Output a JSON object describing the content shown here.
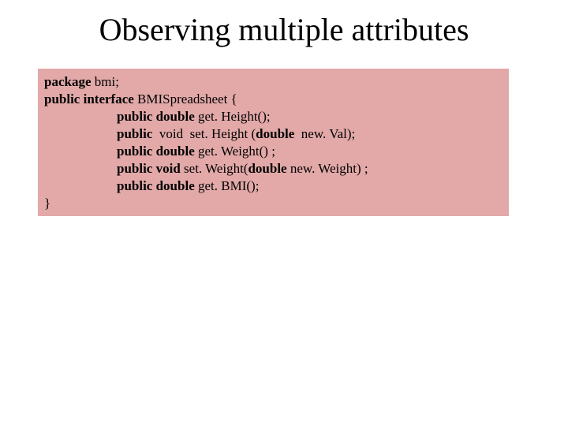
{
  "title": "Observing multiple attributes",
  "code": {
    "l1_kw_package": "package",
    "l1_rest": " bmi; ",
    "l2_kw": "public interface",
    "l2_rest": " BMISpreadsheet {",
    "l3_kw1": "public double",
    "l3_rest": " get. Height(); ",
    "l4_kw1": "public",
    "l4_mid1": "  void  set. Height (",
    "l4_kw2": "double",
    "l4_mid2": "  new. Val); ",
    "l5_kw1": "public double",
    "l5_rest": " get. Weight() ;",
    "l6_kw1": "public void",
    "l6_mid1": " set. Weight(",
    "l6_kw2": "double",
    "l6_mid2": " new. Weight) ;",
    "l7_kw1": "public double",
    "l7_rest": " get. BMI();",
    "l8": "}"
  }
}
